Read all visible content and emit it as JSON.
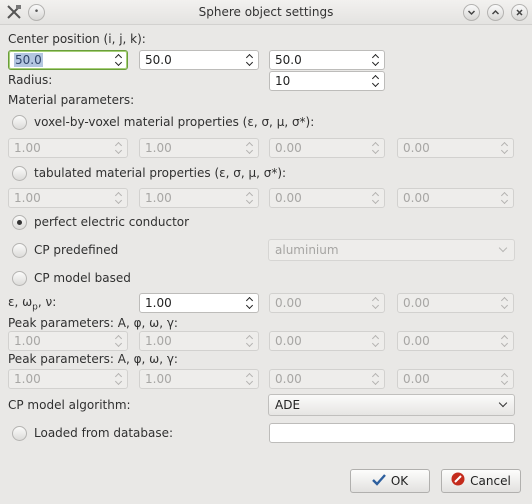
{
  "window": {
    "title": "Sphere object settings"
  },
  "center_position": {
    "label": "Center position (i, j, k):",
    "i": "50.0",
    "j": "50.0",
    "k": "50.0"
  },
  "radius": {
    "label": "Radius:",
    "value": "10"
  },
  "material": {
    "label": "Material parameters:",
    "voxel": {
      "label": "voxel-by-voxel material properties (ε, σ, μ, σ*):",
      "values": [
        "1.00",
        "1.00",
        "0.00",
        "0.00"
      ]
    },
    "tabulated": {
      "label": "tabulated material properties (ε, σ, μ, σ*):",
      "values": [
        "1.00",
        "1.00",
        "0.00",
        "0.00"
      ]
    },
    "pec": {
      "label": "perfect electric conductor",
      "selected": true
    },
    "cp_predefined": {
      "label": "CP predefined",
      "option": "aluminium"
    },
    "cp_model": {
      "label": "CP model based"
    }
  },
  "eps_wp_v": {
    "label_prefix": "ε, ω",
    "label_sub": "p",
    "label_suffix": ", ν:",
    "values": [
      "1.00",
      "0.00",
      "0.00"
    ]
  },
  "peak1": {
    "label": "Peak parameters: A, φ, ω, γ:",
    "values": [
      "1.00",
      "1.00",
      "0.00",
      "0.00"
    ]
  },
  "peak2": {
    "label": "Peak parameters: A, φ, ω, γ:",
    "values": [
      "1.00",
      "1.00",
      "0.00",
      "0.00"
    ]
  },
  "cp_algorithm": {
    "label": "CP model algorithm:",
    "option": "ADE"
  },
  "database": {
    "label": "Loaded from database:",
    "value": ""
  },
  "buttons": {
    "ok": "OK",
    "cancel": "Cancel"
  },
  "colors": {
    "background": "#e9e8e6",
    "focus": "#6a9e3a",
    "ok_icon": "#2d5f9e",
    "cancel_icon": "#c42b1c"
  }
}
